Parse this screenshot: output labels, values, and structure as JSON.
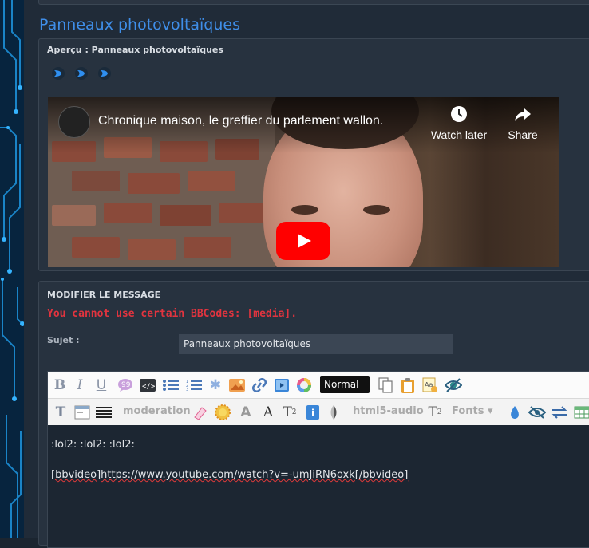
{
  "page": {
    "title": "Panneaux photovoltaïques"
  },
  "preview": {
    "header": "Aperçu : Panneaux photovoltaïques",
    "smileys": [
      "arrow-smiley",
      "arrow-smiley",
      "arrow-smiley"
    ],
    "video": {
      "title": "Chronique maison, le greffier du parlement wallon.",
      "watch_later": "Watch later",
      "share": "Share"
    }
  },
  "edit": {
    "header": "MODIFIER LE MESSAGE",
    "error": "You cannot use certain BBCodes: [media].",
    "subject_label": "Sujet :",
    "subject_value": "Panneaux photovoltaïques",
    "toolbar": {
      "font_size_select": "Normal",
      "moderation_label": "moderation",
      "html5_audio_label": "html5-audio",
      "fonts_label": "Fonts"
    },
    "content": {
      "line1": ":lol2: :lol2: :lol2:",
      "line2_tag_open": "[bbvideo]",
      "line2_url": "https://www.youtube.com/watch?v=-umJiRN6oxk",
      "line2_tag_close": "[/bbvideo]"
    }
  },
  "colors": {
    "accent": "#3f8ee8",
    "error": "#e1343f",
    "panel": "#27323f",
    "background": "#202b38"
  }
}
